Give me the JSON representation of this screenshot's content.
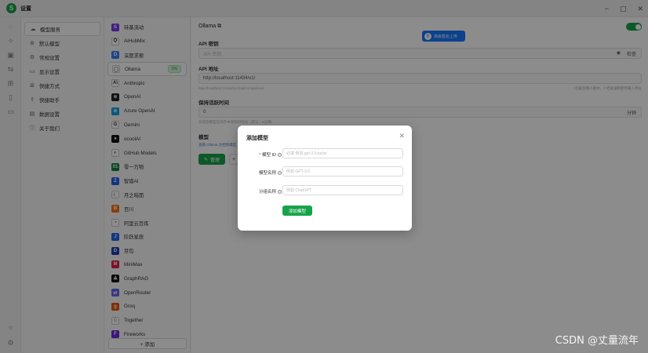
{
  "app": {
    "title": "设置",
    "logo_char": "S"
  },
  "window_controls": {
    "minimize": "−",
    "maximize": "▢",
    "close": "✕"
  },
  "settings_menu": [
    {
      "label": "模型服务",
      "icon": "cloud-icon",
      "glyph": "☁",
      "active": true
    },
    {
      "label": "默认模型",
      "icon": "cube-icon",
      "glyph": "⊛",
      "active": false
    },
    {
      "label": "常规设置",
      "icon": "gear-icon",
      "glyph": "⚙",
      "active": false
    },
    {
      "label": "显示设置",
      "icon": "monitor-icon",
      "glyph": "▭",
      "active": false
    },
    {
      "label": "快捷方式",
      "icon": "grid-icon",
      "glyph": "⊞",
      "active": false
    },
    {
      "label": "快捷助手",
      "icon": "rocket-icon",
      "glyph": "⇪",
      "active": false
    },
    {
      "label": "数据设置",
      "icon": "database-icon",
      "glyph": "▤",
      "active": false
    },
    {
      "label": "关于我们",
      "icon": "info-icon",
      "glyph": "ⓘ",
      "active": false
    }
  ],
  "providers": [
    {
      "label": "硅基流动",
      "color": "#7c3aed",
      "glyph": "S"
    },
    {
      "label": "AiHubMix",
      "color": "#ffffff",
      "glyph": "⛭",
      "dark": true
    },
    {
      "label": "深度求索",
      "color": "#3b82f6",
      "glyph": "D"
    },
    {
      "label": "Ollama",
      "color": "#ffffff",
      "glyph": "◯",
      "dark": true,
      "active": true,
      "badge": "ON"
    },
    {
      "label": "Anthropic",
      "color": "#ffffff",
      "glyph": "A\\",
      "dark": true
    },
    {
      "label": "OpenAI",
      "color": "#222222",
      "glyph": "⊗"
    },
    {
      "label": "Azure OpenAI",
      "color": "#0ea5e9",
      "glyph": "⊗"
    },
    {
      "label": "Gemini",
      "color": "#ffffff",
      "glyph": "G",
      "dark": true
    },
    {
      "label": "ocoolAI",
      "color": "#111111",
      "glyph": "●"
    },
    {
      "label": "GitHub Models",
      "color": "#ffffff",
      "glyph": "◐",
      "dark": true
    },
    {
      "label": "零一万物",
      "color": "#15803d",
      "glyph": "01"
    },
    {
      "label": "智谱AI",
      "color": "#2563eb",
      "glyph": "Z"
    },
    {
      "label": "月之暗面",
      "color": "#ffffff",
      "glyph": "☾",
      "dark": true
    },
    {
      "label": "百川",
      "color": "#f97316",
      "glyph": "B"
    },
    {
      "label": "阿里云百炼",
      "color": "#ffffff",
      "glyph": "◔",
      "dark": true
    },
    {
      "label": "阶跃星辰",
      "color": "#2563eb",
      "glyph": "J"
    },
    {
      "label": "豆包",
      "color": "#1e40af",
      "glyph": "D"
    },
    {
      "label": "MiniMax",
      "color": "#e11d48",
      "glyph": "M"
    },
    {
      "label": "GraphRAG",
      "color": "#111111",
      "glyph": "⟁"
    },
    {
      "label": "OpenRouter",
      "color": "#6366f1",
      "glyph": "⇄"
    },
    {
      "label": "Groq",
      "color": "#ea580c",
      "glyph": "g"
    },
    {
      "label": "Together",
      "color": "#ffffff",
      "glyph": "⁘",
      "dark": true
    },
    {
      "label": "Fireworks",
      "color": "#6d28d9",
      "glyph": "F"
    }
  ],
  "add_provider_label": "+ 添加",
  "main": {
    "provider_title": "Ollama ⧉",
    "api_key_label": "API 密钥",
    "api_key_placeholder": "API 密钥",
    "api_key_check": "检查",
    "api_url_label": "API 地址",
    "api_url_value": "http://localhost:11434/v1/",
    "api_url_hint": "http://localhost:11434/v1/chat/completions",
    "api_url_hint_right": "/ 结尾忽略v1版本，# 结尾强制使用输入地址",
    "keepalive_label": "保持活跃时间",
    "keepalive_value": "0",
    "keepalive_unit": "分钟",
    "keepalive_hint": "对话后模型在内存中保持的时间（默认：5分钟）",
    "models_label": "模型",
    "models_hint": "查看 Ollama 文档和模型",
    "manage_label": "管理",
    "toast_text": "高级签名上传"
  },
  "modal": {
    "title": "添加模型",
    "rows": [
      {
        "label": "模型 ID",
        "required": true,
        "placeholder": "必填 例如 gpt-3.5-turbo"
      },
      {
        "label": "模型名称",
        "required": false,
        "placeholder": "例如 GPT-3.5"
      },
      {
        "label": "分组名称",
        "required": false,
        "placeholder": "例如 ChatGPT"
      }
    ],
    "submit_label": "添加模型"
  },
  "watermark": "CSDN @丈量流年"
}
